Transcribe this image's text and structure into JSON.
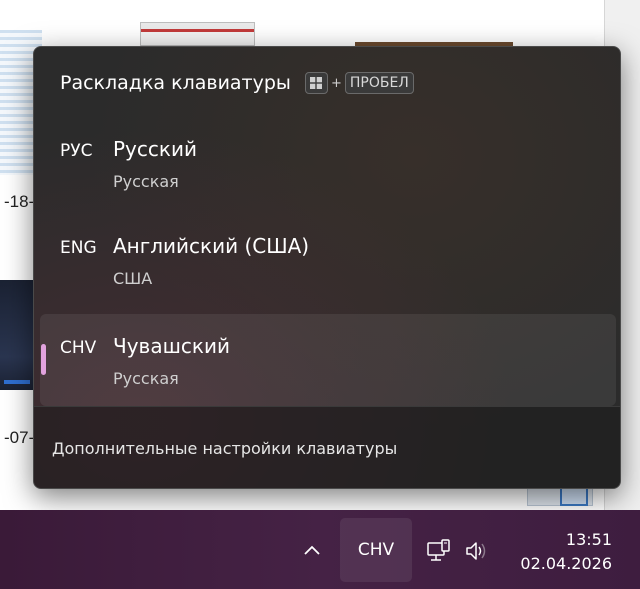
{
  "background": {
    "label_1": "-18-",
    "label_2": "-07-"
  },
  "flyout": {
    "title": "Раскладка клавиатуры",
    "shortcut": {
      "plus": "+",
      "key": "ПРОБЕЛ",
      "icon": "windows-key-icon"
    },
    "layouts": [
      {
        "code": "РУС",
        "name": "Русский",
        "keyboard": "Русская",
        "selected": false
      },
      {
        "code": "ENG",
        "name": "Английский (США)",
        "keyboard": "США",
        "selected": false
      },
      {
        "code": "CHV",
        "name": "Чувашский",
        "keyboard": "Русская",
        "selected": true
      }
    ],
    "footer_link": "Дополнительные настройки клавиатуры",
    "accent_color": "#e2a3de"
  },
  "taskbar": {
    "chevron_icon": "chevron-up-icon",
    "language": "CHV",
    "network_icon": "network-icon",
    "volume_icon": "volume-icon",
    "time": "13:51",
    "date": "02.04.2026"
  }
}
